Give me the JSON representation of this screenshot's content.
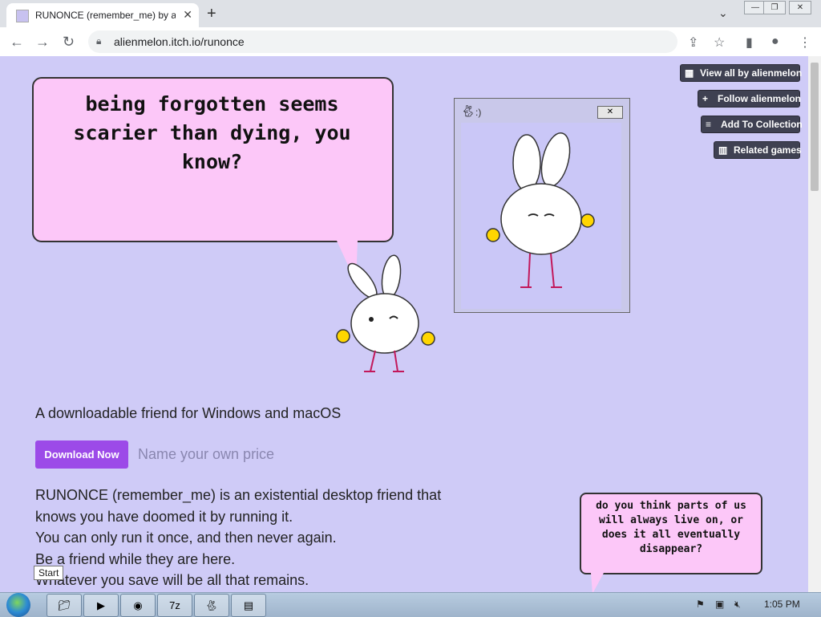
{
  "browser": {
    "tab_title": "RUNONCE (remember_me) by alienmelon",
    "tab_close": "✕",
    "new_tab": "+",
    "tab_menu": "⌄",
    "url": "alienmelon.itch.io/runonce"
  },
  "page": {
    "bubble_text": "being forgotten seems scarier than dying, you know?",
    "mini_window_title": ":)",
    "side_buttons": [
      {
        "label": "View all by alienmelon",
        "icon": "user-grid-icon"
      },
      {
        "label": "Follow alienmelon",
        "icon": "follow-user-icon"
      },
      {
        "label": "Add To Collection",
        "icon": "playlist-add-icon"
      },
      {
        "label": "Related games",
        "icon": "map-icon"
      }
    ],
    "tagline": "A downloadable friend for Windows and macOS",
    "download_label": "Download Now",
    "price_placeholder": "Name your own price",
    "description": [
      "RUNONCE (remember_me) is an existential desktop friend that",
      "knows you have doomed it by running it.",
      "You can only run it once, and then never again.",
      "Be a friend while they are here.",
      "Whatever you save will be all that remains."
    ],
    "bubble2_text": "do you think parts of us will always live on, or does it all eventually disappear?"
  },
  "taskbar": {
    "start_tooltip": "Start",
    "clock": "1:05 PM"
  },
  "colors": {
    "page_bg": "#cfcbf7",
    "bubble_pink": "#fcc7f8",
    "download_purple": "#9c4ae8",
    "side_button": "#3f4152"
  }
}
